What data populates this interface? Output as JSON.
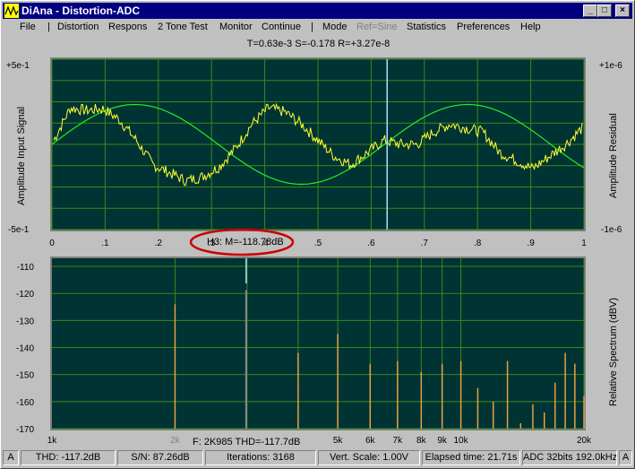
{
  "window": {
    "title": "DiAna - Distortion-ADC"
  },
  "menu": [
    "File",
    "|",
    "Distortion",
    "Respons",
    "2 Tone Test",
    "Monitor",
    "Continue",
    "|",
    "Mode",
    "Ref=Sine",
    "Statistics",
    "Preferences",
    "Help"
  ],
  "readout": "T=0.63e-3  S=-0.178  R=+3.27e-8",
  "top_plot": {
    "ylabel_left": "Amplitude Input Signal",
    "ylabel_right": "Amplitude Residual",
    "left_top": "+5e-1",
    "left_bottom": "-5e-1",
    "right_top": "+1e-6",
    "right_bottom": "-1e-6",
    "xticks": [
      "0",
      ".1",
      ".2",
      ".3",
      ".4",
      ".5",
      ".6",
      ".7",
      ".8",
      ".9",
      "1"
    ],
    "cursor_x": 0.63,
    "colors": {
      "bg": "#003333",
      "grid": "#3a8a1a",
      "sine": "#22ee22",
      "residual": "#ffff33",
      "cursor": "#aaddff"
    }
  },
  "harmonic_label": "H3: M=-118.78dB",
  "bottom_plot": {
    "ylabel_right": "Relative Spectrum (dBV)",
    "yticks": [
      "-110",
      "-120",
      "-130",
      "-140",
      "-150",
      "-160",
      "-170"
    ],
    "xticks": [
      "1k",
      "2k",
      "5k",
      "6k",
      "7k",
      "8k",
      "9k",
      "10k",
      "20k"
    ],
    "freq_label": "F: 2K985 THD=-117.7dB",
    "colors": {
      "bg": "#003333",
      "grid": "#3a8a1a",
      "bars": "#e8a040",
      "cursor": "#aaddff"
    }
  },
  "chart_data": [
    {
      "type": "line",
      "series": [],
      "x_range": [
        0,
        1
      ],
      "y_range_left": [
        -0.5,
        0.5
      ],
      "y_range_right": [
        -1e-06,
        1e-06
      ],
      "grid": true,
      "xticks": [
        0,
        0.1,
        0.2,
        0.3,
        0.4,
        0.5,
        0.6,
        0.7,
        0.8,
        0.9,
        1
      ],
      "sine": {
        "amplitude": 0.45,
        "cycles": 1.6,
        "phase_deg": 0
      },
      "residual_samples": [
        0.05,
        0.45,
        0.42,
        0.44,
        0.3,
        0.05,
        -0.25,
        -0.35,
        -0.45,
        -0.4,
        -0.28,
        -0.05,
        0.25,
        0.45,
        0.4,
        0.25,
        0.05,
        -0.15,
        -0.25,
        -0.1,
        0.05,
        0.0,
        0.0,
        0.15,
        0.25,
        0.2,
        0.15,
        -0.1,
        -0.2,
        -0.3,
        -0.15,
        0.0,
        0.2
      ]
    },
    {
      "type": "bar",
      "ylabel": "Relative Spectrum (dBV)",
      "ylim": [
        -170,
        -107
      ],
      "grid": true,
      "bars": [
        {
          "freq": 2000,
          "db": -124
        },
        {
          "freq": 2985,
          "db": -118.78
        },
        {
          "freq": 4000,
          "db": -142
        },
        {
          "freq": 5000,
          "db": -135
        },
        {
          "freq": 6000,
          "db": -146
        },
        {
          "freq": 7000,
          "db": -145
        },
        {
          "freq": 8000,
          "db": -149
        },
        {
          "freq": 9000,
          "db": -146
        },
        {
          "freq": 10000,
          "db": -145
        },
        {
          "freq": 11000,
          "db": -155
        },
        {
          "freq": 12000,
          "db": -160
        },
        {
          "freq": 13000,
          "db": -145
        },
        {
          "freq": 14000,
          "db": -168
        },
        {
          "freq": 15000,
          "db": -161
        },
        {
          "freq": 16000,
          "db": -164
        },
        {
          "freq": 17000,
          "db": -153
        },
        {
          "freq": 18000,
          "db": -142
        },
        {
          "freq": 19000,
          "db": -146
        },
        {
          "freq": 20000,
          "db": -158
        }
      ]
    }
  ],
  "status": {
    "a_left": "A",
    "thd": "THD: -117.2dB",
    "sn": "S/N: 87.26dB",
    "iterations": "Iterations: 3168",
    "vert": "Vert. Scale: 1.00V",
    "elapsed": "Elapsed time: 21.71s",
    "adc": "ADC 32bits 192.0kHz",
    "a_right": "A"
  }
}
